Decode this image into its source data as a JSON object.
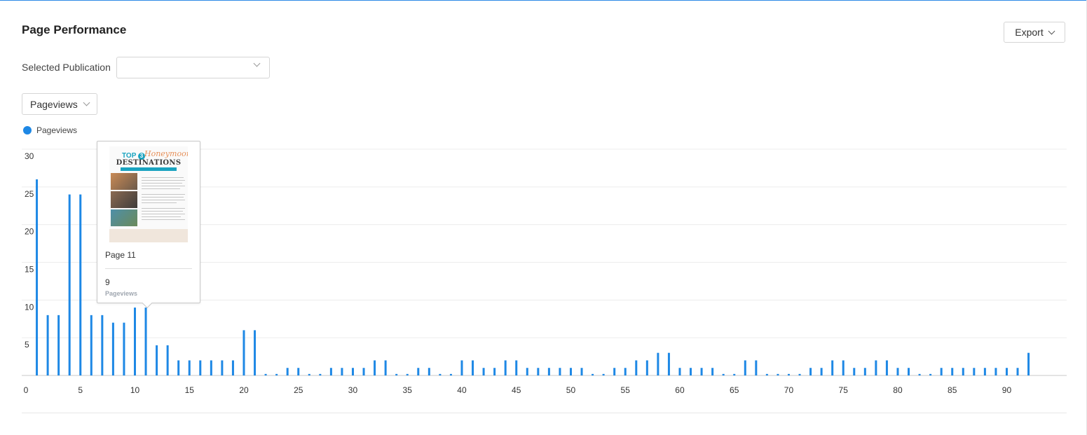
{
  "header": {
    "title": "Page Performance",
    "export_label": "Export"
  },
  "filters": {
    "publication_label": "Selected Publication",
    "publication_value": "",
    "metric_value": "Pageviews"
  },
  "legend": {
    "label": "Pageviews",
    "color": "#1e88e5"
  },
  "tooltip": {
    "thumbnail": {
      "top_text": "TOP",
      "top_number": "3",
      "script_text": "Honeymoon",
      "headline": "DESTINATIONS"
    },
    "page_label": "Page 11",
    "value": "9",
    "metric": "Pageviews"
  },
  "chart_data": {
    "type": "bar",
    "series": [
      {
        "name": "Pageviews",
        "color": "#1e88e5",
        "x": [
          1,
          2,
          3,
          4,
          5,
          6,
          7,
          8,
          9,
          10,
          11,
          12,
          13,
          14,
          15,
          16,
          17,
          18,
          19,
          20,
          21,
          22,
          23,
          24,
          25,
          26,
          27,
          28,
          29,
          30,
          31,
          32,
          33,
          34,
          35,
          36,
          37,
          38,
          39,
          40,
          41,
          42,
          43,
          44,
          45,
          46,
          47,
          48,
          49,
          50,
          51,
          52,
          53,
          54,
          55,
          56,
          57,
          58,
          59,
          60,
          61,
          62,
          63,
          64,
          65,
          66,
          67,
          68,
          69,
          70,
          71,
          72,
          73,
          74,
          75,
          76,
          77,
          78,
          79,
          80,
          81,
          82,
          83,
          84,
          85,
          86,
          87,
          88,
          89,
          90,
          91,
          92
        ],
        "values": [
          26,
          8,
          8,
          24,
          24,
          8,
          8,
          7,
          7,
          9,
          9,
          4,
          4,
          2,
          2,
          2,
          2,
          2,
          2,
          6,
          6,
          0.2,
          0.2,
          1,
          1,
          0.2,
          0.2,
          1,
          1,
          1,
          1,
          2,
          2,
          0.2,
          0.2,
          1,
          1,
          0.2,
          0.2,
          2,
          2,
          1,
          1,
          2,
          2,
          1,
          1,
          1,
          1,
          1,
          1,
          0.2,
          0.2,
          1,
          1,
          2,
          2,
          3,
          3,
          1,
          1,
          1,
          1,
          0.2,
          0.2,
          2,
          2,
          0.2,
          0.2,
          0.2,
          0.2,
          1,
          1,
          2,
          2,
          1,
          1,
          2,
          2,
          1,
          1,
          0.2,
          0.2,
          1,
          1,
          1,
          1,
          1,
          1,
          1,
          1,
          3
        ]
      }
    ],
    "xlim": [
      0,
      95.5
    ],
    "ylim": [
      0,
      30
    ],
    "x_ticks": [
      0,
      5,
      10,
      15,
      20,
      25,
      30,
      35,
      40,
      45,
      50,
      55,
      60,
      65,
      70,
      75,
      80,
      85,
      90
    ],
    "y_ticks": [
      5,
      10,
      15,
      20,
      25,
      30
    ],
    "grid": true,
    "legend_position": "top-left"
  }
}
